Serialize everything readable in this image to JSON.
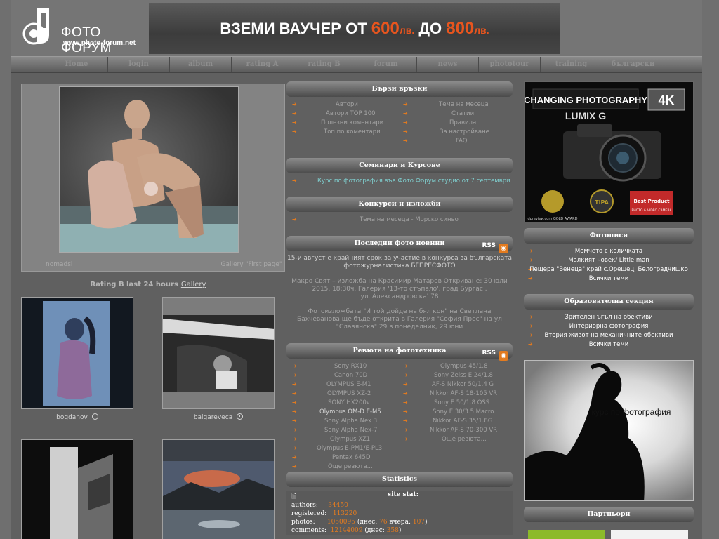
{
  "header": {
    "logo_name": "ФОТО ФОРУМ",
    "logo_url": "www.photo-forum.net",
    "banner": {
      "prefix": "ВЗЕМИ ВАУЧЕР ОТ ",
      "amount1": "600",
      "unit1": "лв.",
      "middle": " ДО ",
      "amount2": "800",
      "unit2": "лв."
    }
  },
  "menu": [
    "Home",
    "login",
    "album",
    "rating A",
    "rating B",
    "forum",
    "news",
    "phototour",
    "training",
    "български"
  ],
  "featured": {
    "author": "nomadsi",
    "gallery": "Gallery \"First page\""
  },
  "rating": {
    "label": "Rating B last 24 hours",
    "gallery": "Gallery"
  },
  "thumbs": [
    {
      "author": "bogdanov"
    },
    {
      "author": "balgareveca"
    },
    {
      "author": ""
    },
    {
      "author": ""
    }
  ],
  "quick_links": {
    "title": "Бързи връзки",
    "left": [
      "Автори",
      "Автори TOP 100",
      "Полезни коментари",
      "Топ по коментари"
    ],
    "right": [
      "Тема на месеца",
      "Статии",
      "Правила",
      "За настройване",
      "FAQ"
    ]
  },
  "seminars": {
    "title": "Семинари и Курсове",
    "items": [
      "Курс по фотография във Фото Форум студио от 7 септември"
    ]
  },
  "contests": {
    "title": "Конкурси и изложби",
    "items": [
      "Тема на месеца - Морско синьо"
    ]
  },
  "photo_news": {
    "title": "Последни фото новини",
    "rss": "RSS",
    "items": [
      "15-и август е крайният срок за участие в конкурса за българската фотожурналистика БГПРЕСФОТО",
      "Макро Свят – изложба на Красимир Матаров Откриване: 30 юли 2015, 18:30ч. Галерия '13-то стъпало', град Бургас , ул.'Александровска' 78",
      "Фотоизложбата \"И той дойде на бял кон\" на Светлана Бахчеванова ще бъде открита в Галерия \"София Прес\" на ул \"Славянска\" 29 в понеделник, 29 юни"
    ]
  },
  "reviews": {
    "title": "Ревюта на фототехника",
    "rss": "RSS",
    "left": [
      "Sony RX10",
      "Canon 70D",
      "OLYMPUS E-M1",
      "OLYMPUS XZ-2",
      "SONY HX200v",
      "Olympus OM-D E-M5",
      "Sony Alpha Nex 3",
      "Sony Alpha Nex-7",
      "Olympus XZ1",
      "Olympus E-PM1/E-PL3",
      "Pentax 645D",
      "Още ревюта..."
    ],
    "right": [
      "Olympus 45/1.8",
      "Sony Zeiss E 24/1.8",
      "AF-S Nikkor 50/1.4 G",
      "Nikkor AF-S 18-105 VR",
      "Sony E 50/1.8 OSS",
      "Sony E 30/3.5 Macro",
      "Nikkor AF-S 35/1.8G",
      "Nikkor AF-S 70-300 VR",
      "Още ревюта..."
    ]
  },
  "statistics": {
    "title": "Statistics",
    "site_stat": "site stat:",
    "authors_label": "authors:",
    "authors": "34450",
    "registered_label": "registered:",
    "registered": "113220",
    "photos_label": "photos:",
    "photos": "1050095",
    "today_label": "(днес:",
    "photos_today": "76",
    "yesterday_label": "вчера:",
    "photos_yesterday": "107",
    "comments_label": "comments:",
    "comments": "12144009",
    "comments_today_label": "(днес:",
    "comments_today": "358"
  },
  "ad_lumix": {
    "headline": "CHANGING PHOTOGRAPHY",
    "brand": "LUMIX G",
    "badge": "4K",
    "award1": "dpreview.com GOLD AWARD",
    "award2": "TIPA",
    "award3": "Best Product",
    "award3_sub": "PHOTO & VIDEO CAMERA"
  },
  "photo_stories": {
    "title": "Фотописи",
    "items": [
      "Момчето с количката",
      "Малкият човек/ Little man",
      "Пещера \"Венеца\" край с.Орешец, Белоградчишко",
      "Всички теми"
    ]
  },
  "education": {
    "title": "Образователна секция",
    "items": [
      "Зрителен ъгъл на обективи",
      "Интериорна фотография",
      "Втория живот на механичните обективи",
      "Всички теми"
    ]
  },
  "ad_course": {
    "text": "курс  по фотография"
  },
  "partners": {
    "title": "Партньори"
  },
  "colors": {
    "accent": "#e37b1f",
    "link_cyan": "#7fd0d0"
  }
}
